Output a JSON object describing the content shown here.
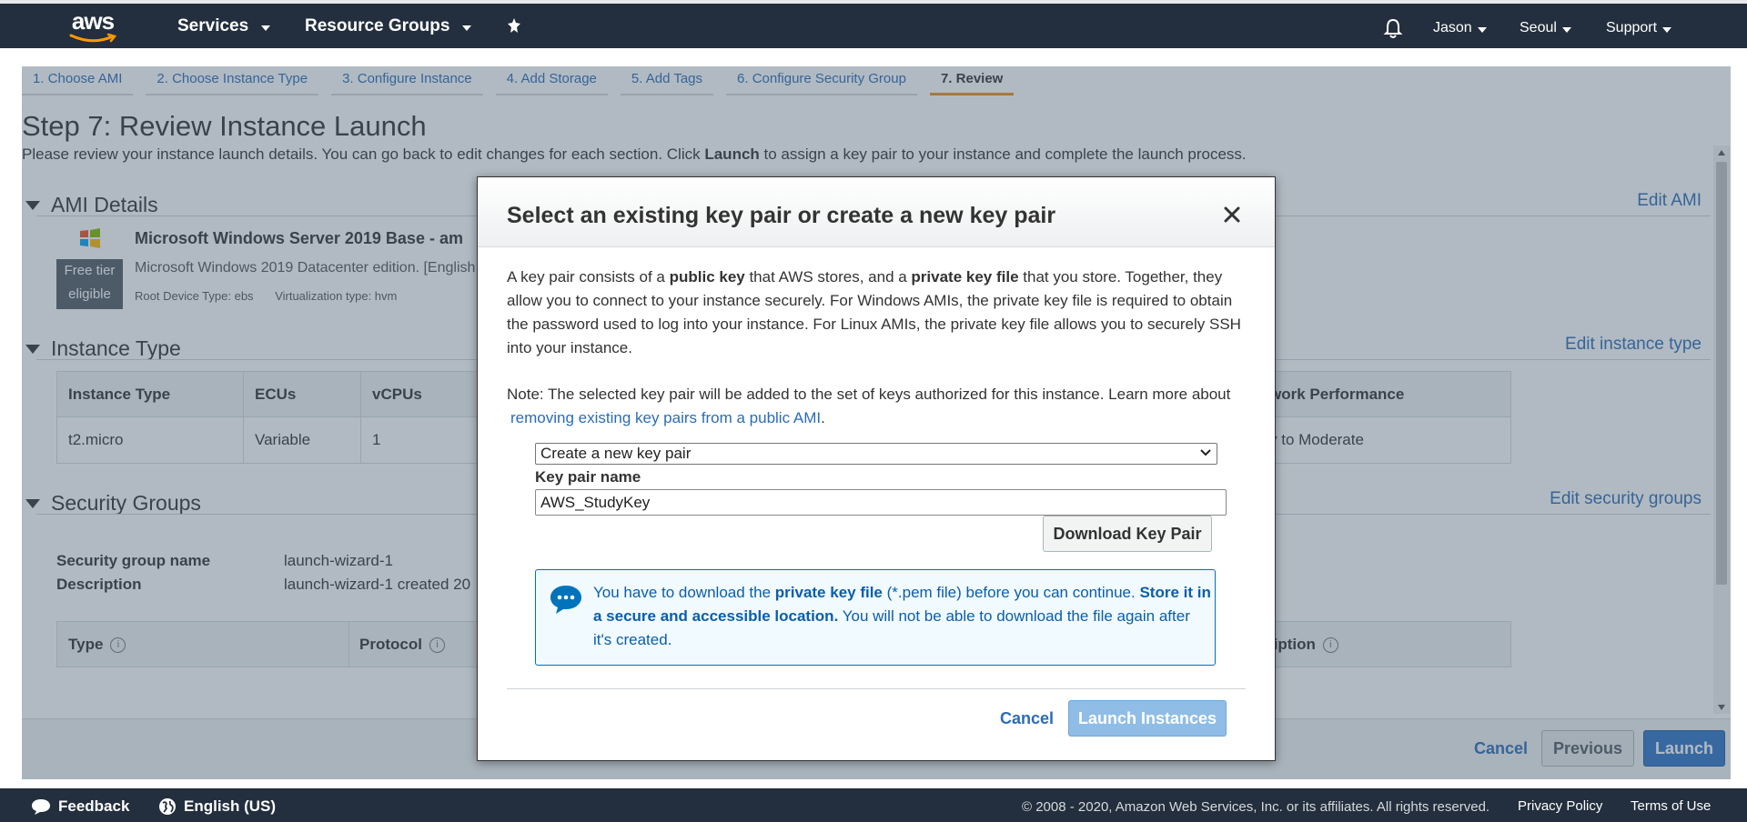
{
  "topnav": {
    "logo": "aws",
    "services": "Services",
    "resource_groups": "Resource Groups",
    "user": "Jason",
    "region": "Seoul",
    "support": "Support"
  },
  "wizard": {
    "steps": [
      "1. Choose AMI",
      "2. Choose Instance Type",
      "3. Configure Instance",
      "4. Add Storage",
      "5. Add Tags",
      "6. Configure Security Group",
      "7. Review"
    ],
    "active_step": "7. Review"
  },
  "page": {
    "title": "Step 7: Review Instance Launch",
    "desc_before": "Please review your instance launch details. You can go back to edit changes for each section. Click ",
    "desc_bold": "Launch",
    "desc_after": " to assign a key pair to your instance and complete the launch process."
  },
  "ami": {
    "section": "AMI Details",
    "edit": "Edit AMI",
    "free_tier_1": "Free tier",
    "free_tier_2": "eligible",
    "name": "Microsoft Windows Server 2019 Base - am",
    "description": "Microsoft Windows 2019 Datacenter edition. [English",
    "root_device": "Root Device Type: ebs",
    "virtualization": "Virtualization type: hvm"
  },
  "instance_type": {
    "section": "Instance Type",
    "edit": "Edit instance type",
    "headers": [
      "Instance Type",
      "ECUs",
      "vCPUs",
      "work Performance"
    ],
    "row": [
      "t2.micro",
      "Variable",
      "1",
      "y to Moderate"
    ]
  },
  "security_groups": {
    "section": "Security Groups",
    "edit": "Edit security groups",
    "name_label": "Security group name",
    "name_value": "launch-wizard-1",
    "desc_label": "Description",
    "desc_value": "launch-wizard-1 created 20",
    "headers": [
      "Type",
      "Protocol",
      "ription"
    ]
  },
  "bottom_actions": {
    "cancel": "Cancel",
    "previous": "Previous",
    "launch": "Launch"
  },
  "modal": {
    "title": "Select an existing key pair or create a new key pair",
    "p1_a": "A key pair consists of a ",
    "p1_b": "public key",
    "p1_c": " that AWS stores, and a ",
    "p1_d": "private key file",
    "p1_e": " that you store. Together, they allow you to connect to your instance securely. For Windows AMIs, the private key file is required to obtain the password used to log into your instance. For Linux AMIs, the private key file allows you to securely SSH into your instance.",
    "p2_a": "Note: The selected key pair will be added to the set of keys authorized for this instance. Learn more about ",
    "p2_link": "removing existing key pairs from a public AMI",
    "p2_b": ".",
    "select_value": "Create a new key pair",
    "key_name_label": "Key pair name",
    "key_name_value": "AWS_StudyKey",
    "download_button": "Download Key Pair",
    "info_a": "You have to download the ",
    "info_b": "private key file",
    "info_c": " (*.pem file) before you can continue. ",
    "info_d": "Store it in a secure and accessible location.",
    "info_e": " You will not be able to download the file again after it's created.",
    "cancel": "Cancel",
    "launch": "Launch Instances"
  },
  "footer": {
    "feedback": "Feedback",
    "language": "English (US)",
    "copyright": "© 2008 - 2020, Amazon Web Services, Inc. or its affiliates. All rights reserved.",
    "privacy": "Privacy Policy",
    "terms": "Terms of Use"
  },
  "colors": {
    "nav_bg": "#232f3e",
    "link": "#2b6cb7",
    "active_tab": "#f08c1c",
    "primary_button": "#2f73c4"
  }
}
